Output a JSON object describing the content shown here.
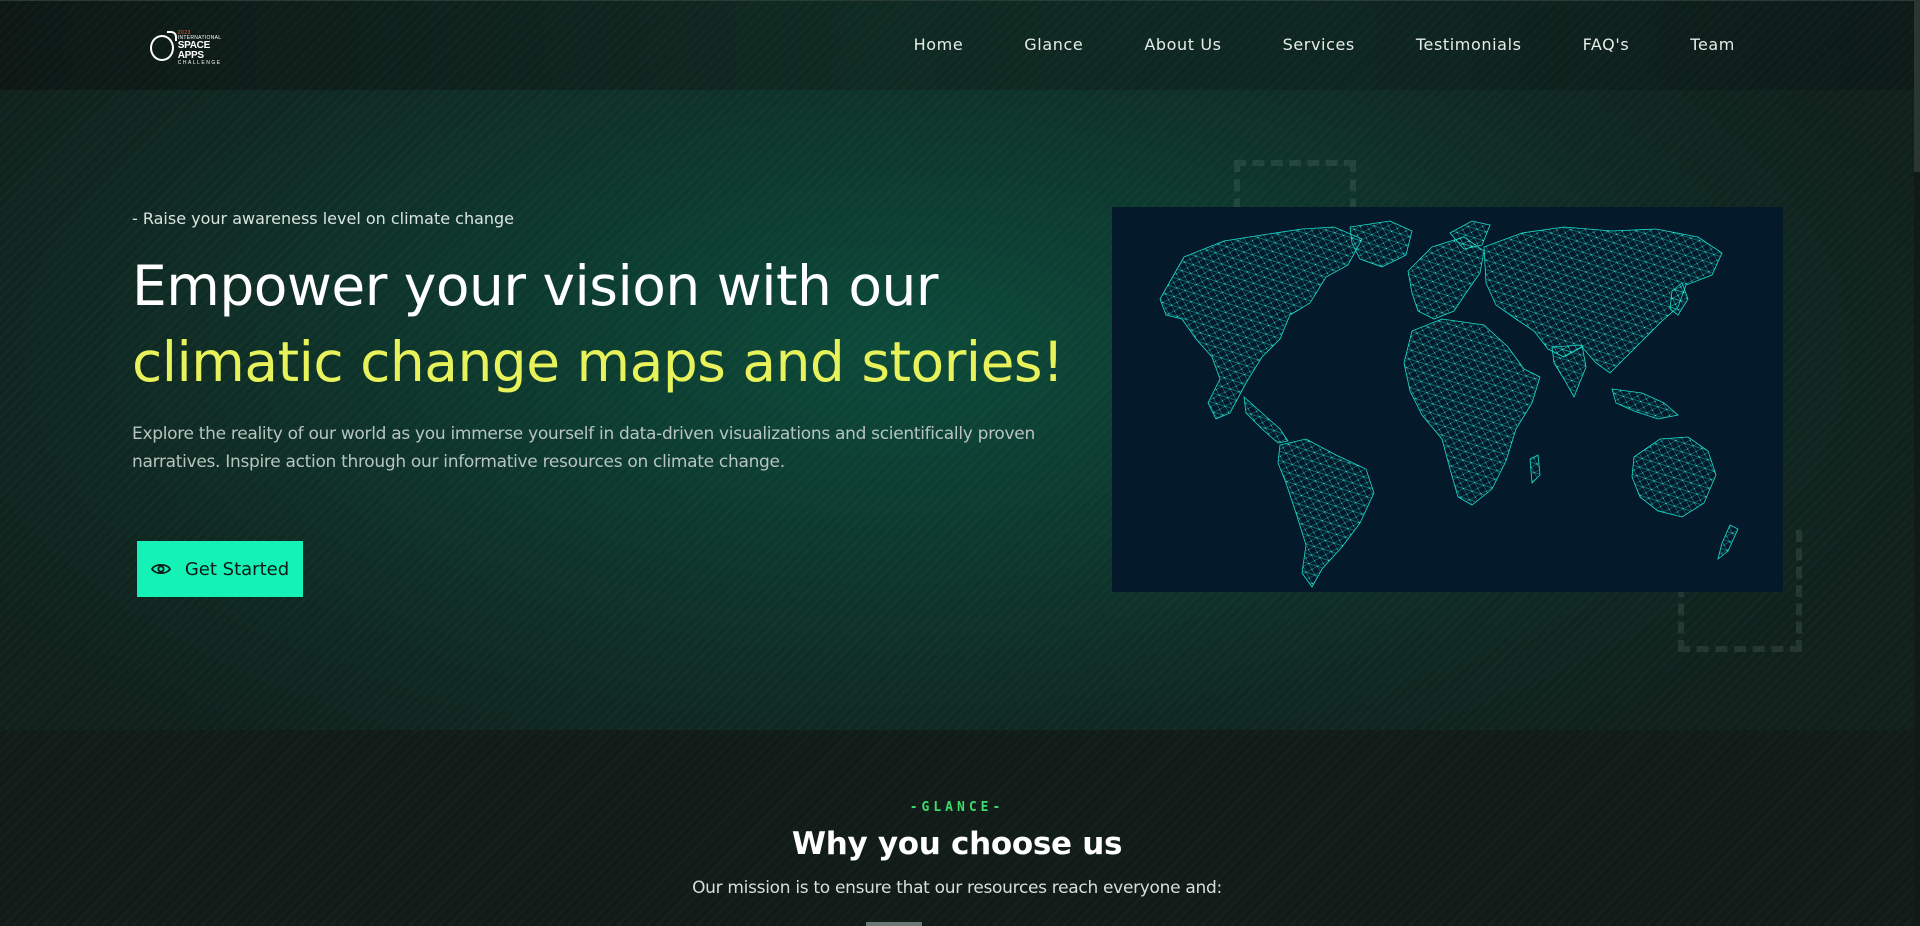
{
  "brand": {
    "logo_line1": "2023",
    "logo_line2": "INTERNATIONAL",
    "logo_line3": "SPACE APPS",
    "logo_line4": "CHALLENGE"
  },
  "nav": {
    "items": [
      "Home",
      "Glance",
      "About Us",
      "Services",
      "Testimonials",
      "FAQ's",
      "Team"
    ]
  },
  "hero": {
    "tagline": "- Raise your awareness level on climate change",
    "headline_plain": "Empower your vision with our ",
    "headline_accent": "climatic change maps and stories!",
    "description": "Explore the reality of our world as you immerse yourself in data-driven visualizations and scientifically proven narratives. Inspire action through our informative resources on climate change.",
    "cta_label": "Get Started",
    "cta_icon": "eye-icon",
    "map_image": "world-network-map"
  },
  "glance": {
    "eyebrow": "-GLANCE-",
    "title": "Why you choose us",
    "subtitle": "Our mission is to ensure that our resources reach everyone and:"
  },
  "colors": {
    "accent_yellow": "#e8f25a",
    "cta_green": "#14f2b6",
    "eyebrow_green": "#3ddc6a",
    "map_bg": "#04192a",
    "map_lines": "#1de9d6"
  }
}
